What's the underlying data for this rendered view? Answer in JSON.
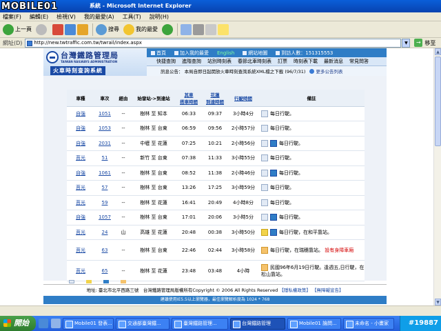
{
  "window": {
    "title": "系統 - Microsoft Internet Explorer",
    "watermark": "MOBILE01"
  },
  "menu": [
    "檔案(F)",
    "編輯(E)",
    "檢視(V)",
    "我的最愛(A)",
    "工具(T)",
    "說明(H)"
  ],
  "toolbar": {
    "back": "上一頁",
    "search": "搜尋",
    "favorites": "我的最愛"
  },
  "address": {
    "label": "網址(D)",
    "url": "http://new.twtraffic.com.tw/twrail/index.aspx",
    "go": "移至"
  },
  "rail": {
    "name": "台灣鐵路管理局",
    "ename": "TAIWAN RAILWAYS ADMINISTRATION",
    "sub": "火車時刻查詢系統",
    "topnav": [
      "首頁",
      "加入我的最愛",
      "English",
      "網站地圖",
      "到訪人數：151315553"
    ],
    "subnav": [
      "快捷查詢",
      "進階查詢",
      "站別時刻表",
      "春節北車時刻表",
      "訂票",
      "時刻表下載",
      "最新消息",
      "常見問答"
    ],
    "notice": "訊息公告： 本局自即日起開放火車時刻查詢系統XML檔之下載 (96/7/31)",
    "notice_more": "更多公告列表"
  },
  "table": {
    "headers": [
      "車種",
      "車次",
      "經由",
      "始發站->到達站",
      "出發時間",
      "到達時間",
      "行駛時間",
      "備註"
    ],
    "header_depart": [
      "其車",
      "搭車時間"
    ],
    "header_arrive": [
      "花蓮",
      "到達時間"
    ],
    "rows": [
      {
        "type": "自強",
        "no": "1051",
        "via": "--",
        "route": "樹林 至 知本",
        "dep": "06:33",
        "arr": "09:37",
        "dur": "3小時4分",
        "icons": [
          "plain"
        ],
        "note": "每日行駛。",
        "note_red": ""
      },
      {
        "type": "自強",
        "no": "1053",
        "via": "--",
        "route": "樹林 至 台東",
        "dep": "06:59",
        "arr": "09:56",
        "dur": "2小時57分",
        "icons": [
          "plain"
        ],
        "note": "每日行駛。",
        "note_red": ""
      },
      {
        "type": "自強",
        "no": "2031",
        "via": "--",
        "route": "中壢 至 花蓮",
        "dep": "07:25",
        "arr": "10:21",
        "dur": "2小時56分",
        "icons": [
          "plain",
          "wheel"
        ],
        "note": "每日行駛。",
        "note_red": ""
      },
      {
        "type": "莒光",
        "no": "51",
        "via": "--",
        "route": "新竹 至 台東",
        "dep": "07:38",
        "arr": "11:33",
        "dur": "3小時55分",
        "icons": [
          "plain"
        ],
        "note": "每日行駛。",
        "note_red": ""
      },
      {
        "type": "自強",
        "no": "1061",
        "via": "--",
        "route": "樹林 至 台東",
        "dep": "08:52",
        "arr": "11:38",
        "dur": "2小時46分",
        "icons": [
          "plain",
          "wheel"
        ],
        "note": "每日行駛。",
        "note_red": ""
      },
      {
        "type": "莒光",
        "no": "57",
        "via": "--",
        "route": "樹林 至 台東",
        "dep": "13:26",
        "arr": "17:25",
        "dur": "3小時59分",
        "icons": [
          "plain"
        ],
        "note": "每日行駛。",
        "note_red": ""
      },
      {
        "type": "莒光",
        "no": "59",
        "via": "--",
        "route": "樹林 至 花蓮",
        "dep": "16:41",
        "arr": "20:49",
        "dur": "4小時8分",
        "icons": [
          "plain"
        ],
        "note": "每日行駛。",
        "note_red": ""
      },
      {
        "type": "自強",
        "no": "1057",
        "via": "--",
        "route": "樹林 至 台東",
        "dep": "17:01",
        "arr": "20:06",
        "dur": "3小時5分",
        "icons": [
          "plain",
          "wheel"
        ],
        "note": "每日行駛。",
        "note_red": ""
      },
      {
        "type": "莒光",
        "no": "24",
        "via": "山",
        "route": "高雄 至 花蓮",
        "dep": "20:48",
        "arr": "00:38",
        "dur": "3小時50分",
        "icons": [
          "bike",
          "wheel"
        ],
        "note": "每日行駛，在和平靠站。",
        "note_red": ""
      },
      {
        "type": "莒光",
        "no": "63",
        "via": "--",
        "route": "樹林 至 台東",
        "dep": "22:46",
        "arr": "02:44",
        "dur": "3小時58分",
        "icons": [
          "bento"
        ],
        "note": "每日行駛，在瑞穗靠站。",
        "note_red": "設有身障車廂",
        "tall": true
      },
      {
        "type": "莒光",
        "no": "65",
        "via": "--",
        "route": "樹林 至 花蓮",
        "dep": "23:48",
        "arr": "03:48",
        "dur": "4小時",
        "icons": [
          "bento"
        ],
        "note": "民國96年6月19日行駛。逢週五,日行駛，在松山靠站。",
        "note_red": "",
        "tall": true
      }
    ]
  },
  "footer": {
    "line1": "地址: 臺北市北平西路三號　台灣鐵路管理局版權所有Copyright © 2006 All Rights Reserved",
    "privacy": "【隱私權政策】",
    "access": "【無障礙宣告】",
    "line2": "建議使用IE5.5以上瀏覽器，最佳瀏覽解析度為 1024 * 768"
  },
  "taskbar": {
    "start": "開始",
    "tasks": [
      "Mobile01 發表...",
      "交通部臺灣鐵...",
      "臺灣鐵路管理...",
      "台灣鐵路管理",
      "Mobile01 論問...",
      "未命名 - 小畫家"
    ],
    "active_index": 3,
    "tray": "#19887"
  }
}
